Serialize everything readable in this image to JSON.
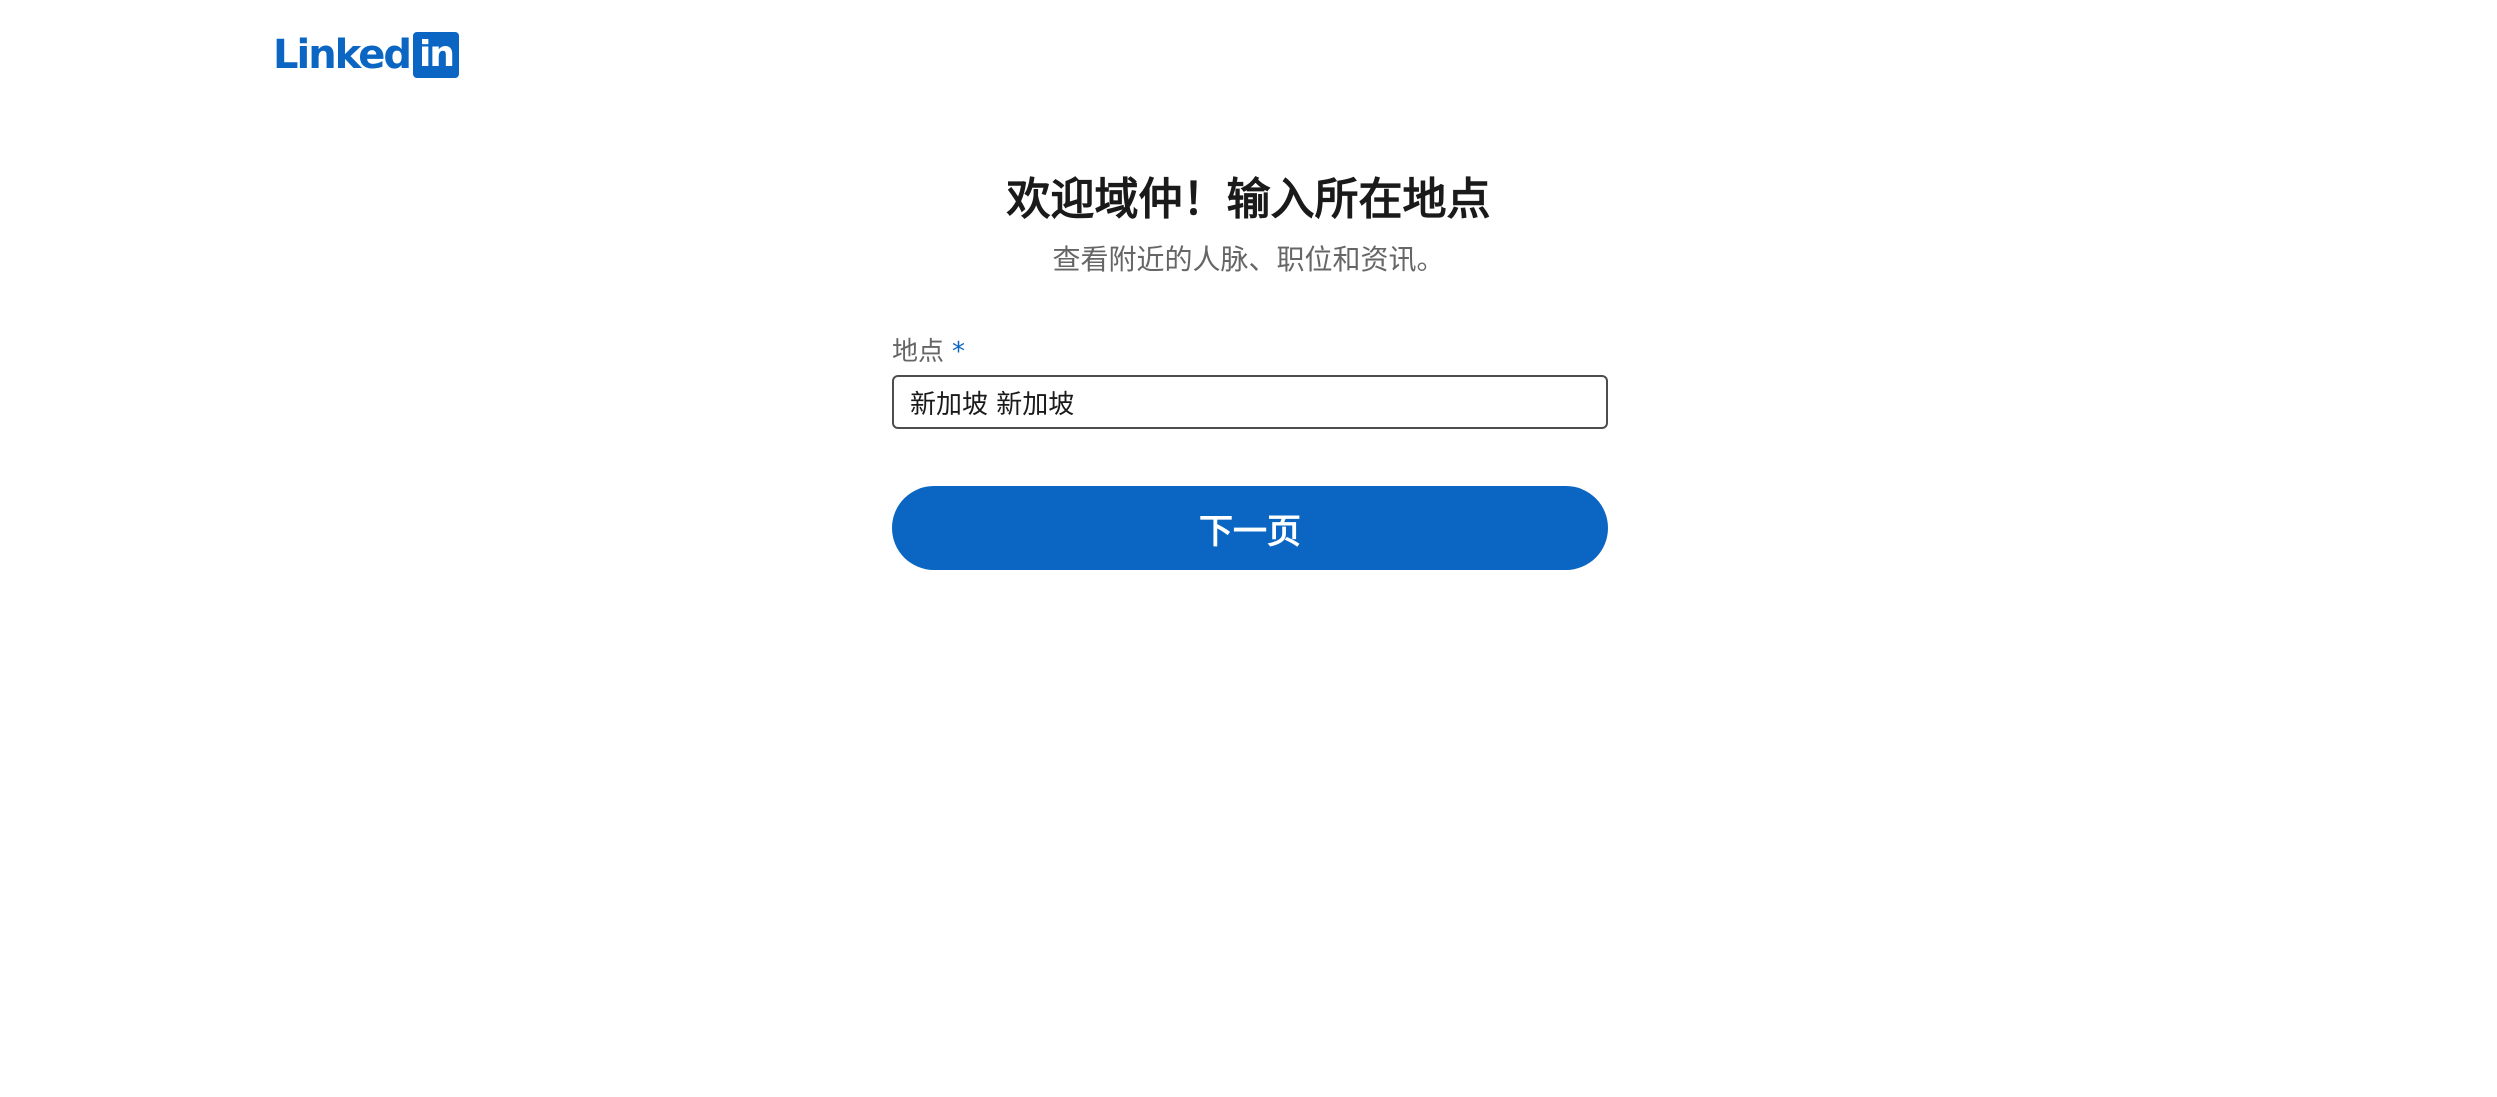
{
  "brand": {
    "logo_word": "Linked",
    "logo_box": "in",
    "color": "#0a66c2"
  },
  "onboarding": {
    "title": "欢迎域仲！输入所在地点",
    "subtitle": "查看附近的人脉、职位和资讯。"
  },
  "location_field": {
    "label": "地点",
    "required_mark": "*",
    "value": "新加坡 新加坡"
  },
  "next_button": {
    "label": "下一页"
  }
}
